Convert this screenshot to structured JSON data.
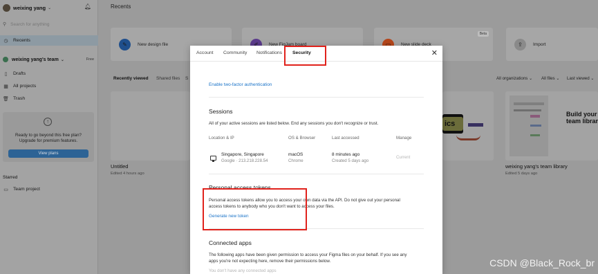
{
  "sidebar": {
    "user_name": "weixing yang",
    "search_placeholder": "Search for anything",
    "recents_label": "Recents",
    "team_name": "weixing yang's team",
    "team_badge": "Free",
    "items": [
      {
        "label": "Drafts",
        "icon": "file-icon"
      },
      {
        "label": "All projects",
        "icon": "grid-icon"
      },
      {
        "label": "Trash",
        "icon": "trash-icon"
      }
    ],
    "upgrade_text": "Ready to go beyond this free plan? Upgrade for premium features.",
    "upgrade_line1": "Ready to go beyond this free plan?",
    "upgrade_line2": "Upgrade for premium features.",
    "upgrade_button": "View plans",
    "starred_label": "Starred",
    "starred_items": [
      {
        "label": "Team project",
        "icon": "folder-icon"
      }
    ]
  },
  "main": {
    "title": "Recents",
    "quick_actions": [
      {
        "label": "New design file",
        "icon": "design-icon",
        "color": "#1f4f8c"
      },
      {
        "label": "New FigJam board",
        "icon": "figjam-icon",
        "color": "#5b3b8c"
      },
      {
        "label": "New slide deck",
        "icon": "slides-icon",
        "color": "#b5461b",
        "badge": "Beta"
      },
      {
        "label": "Import",
        "icon": "import-icon",
        "color": "#8a8a8a"
      }
    ],
    "tabs": [
      "Recently viewed",
      "Shared files",
      "S"
    ],
    "filters": [
      "All organizations",
      "All files",
      "Last viewed"
    ],
    "files": [
      {
        "name": "Untitled",
        "meta": "Edited 4 hours ago"
      },
      {
        "name": "weixing yang's team library",
        "meta": "Edited 5 days ago"
      }
    ],
    "thumb_text_1": "ics",
    "thumb_text_2": "Build your o",
    "thumb_text_3": "team library"
  },
  "modal": {
    "tabs": [
      {
        "label": "Account",
        "active": false
      },
      {
        "label": "Community",
        "active": false
      },
      {
        "label": "Notifications",
        "active": false
      },
      {
        "label": "Security",
        "active": true
      }
    ],
    "two_factor_link": "Enable two-factor authentication",
    "sessions": {
      "title": "Sessions",
      "description": "All of your active sessions are listed below. End any sessions you don't recognize or trust.",
      "columns": [
        "Location & IP",
        "OS & Browser",
        "Last accessed",
        "Manage"
      ],
      "rows": [
        {
          "location": "Singapore, Singapore",
          "ip": "Google · 213.218.228.54",
          "os": "macOS",
          "browser": "Chrome",
          "last_accessed": "8 minutes ago",
          "created": "Created 5 days ago",
          "manage": "Current"
        }
      ]
    },
    "tokens": {
      "title": "Personal access tokens",
      "description_line1": "Personal access tokens allow you to access your own data via the API. Do not give out your personal",
      "description_line2": "access tokens to anybody who you don't want to access your files.",
      "generate_link": "Generate new token"
    },
    "connected_apps": {
      "title": "Connected apps",
      "description_line1": "The following apps have been given permission to access your Figma files on your behalf. If you see any",
      "description_line2": "apps you're not expecting here, remove their permissions below.",
      "empty_text": "You don't have any connected apps"
    }
  },
  "watermark": "CSDN @Black_Rock_br",
  "colors": {
    "highlight": "#e0211b",
    "link": "#1a73c8"
  }
}
